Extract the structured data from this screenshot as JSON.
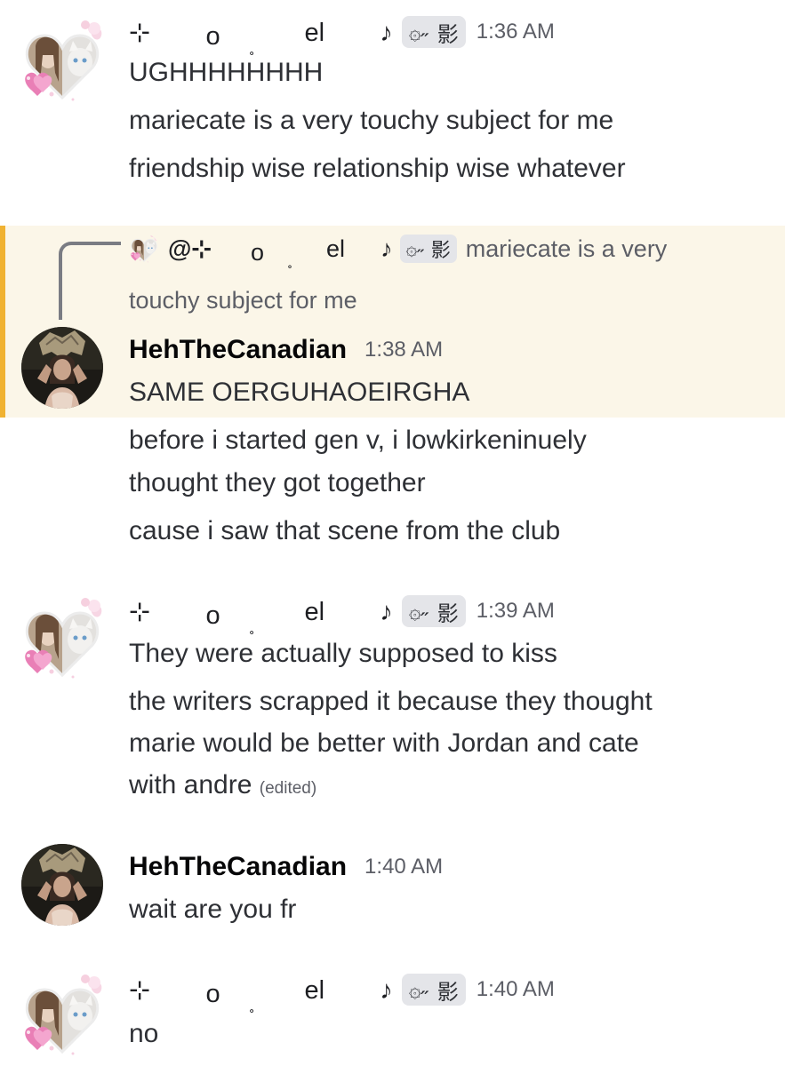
{
  "users": {
    "el": {
      "deco": [
        "⊹",
        "o",
        "˳",
        "el",
        "♪"
      ],
      "badge_icon": "۞˶",
      "badge_text": "影"
    },
    "heh": {
      "name": "HehTheCanadian"
    }
  },
  "groups": [
    {
      "time": "1:36 AM",
      "messages": [
        "UGHHHHHHHH",
        "mariecate is a very touchy subject for me",
        "friendship wise relationship wise whatever"
      ]
    },
    {
      "reply": {
        "mention": "@⊹",
        "preview_line1": "mariecate is a very",
        "preview_line2": "touchy subject for me"
      },
      "time": "1:38 AM",
      "messages": [
        "SAME OERGUHAOEIRGHA",
        "before i started gen v, i lowkirkeninuely",
        "thought they got together",
        "cause i saw that scene from the club"
      ]
    },
    {
      "time": "1:39 AM",
      "messages": [
        "They were actually supposed to kiss",
        "the writers scrapped it because they thought",
        "marie would be better with Jordan and cate",
        "with andre"
      ],
      "edited": "(edited)"
    },
    {
      "time": "1:40 AM",
      "messages": [
        "wait are you fr"
      ]
    },
    {
      "time": "1:40 AM",
      "messages": [
        "no"
      ]
    }
  ],
  "colors": {
    "highlight_bg": "#fbf6e8",
    "highlight_bar": "#f0b232",
    "badge_bg": "#e4e5e9",
    "timestamp": "#5c5e66"
  }
}
